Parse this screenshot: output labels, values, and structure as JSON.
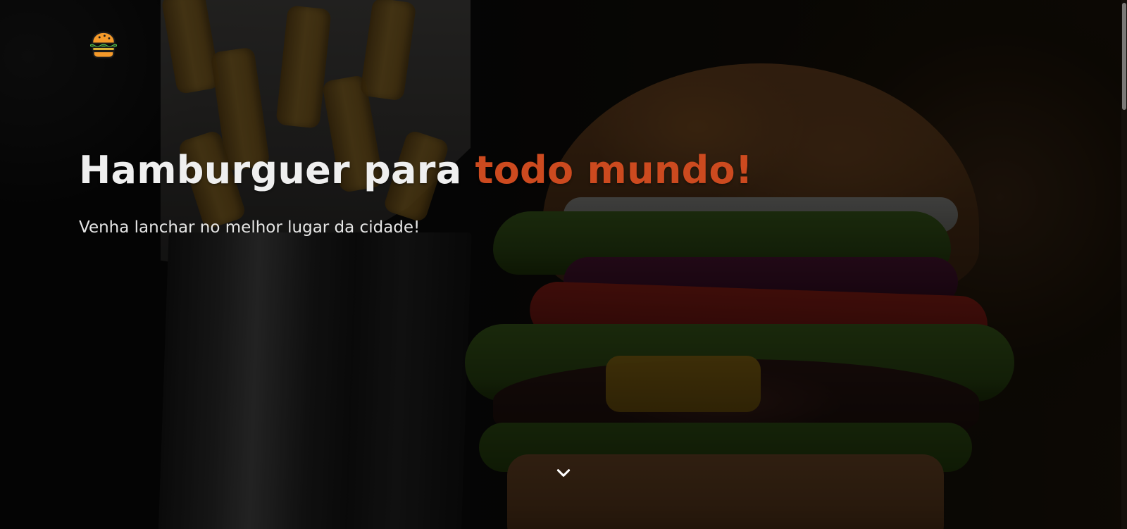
{
  "hero": {
    "title_main": "Hamburguer para ",
    "title_highlight": "todo mundo!",
    "subtitle": "Venha lanchar no melhor lugar da cidade!"
  },
  "logo": {
    "icon": "burger-icon"
  },
  "scroll_indicator": {
    "icon": "chevron-down-icon"
  },
  "colors": {
    "accent": "#cc4a1f",
    "text_primary": "#efefef",
    "text_secondary": "#e6e6e6"
  }
}
